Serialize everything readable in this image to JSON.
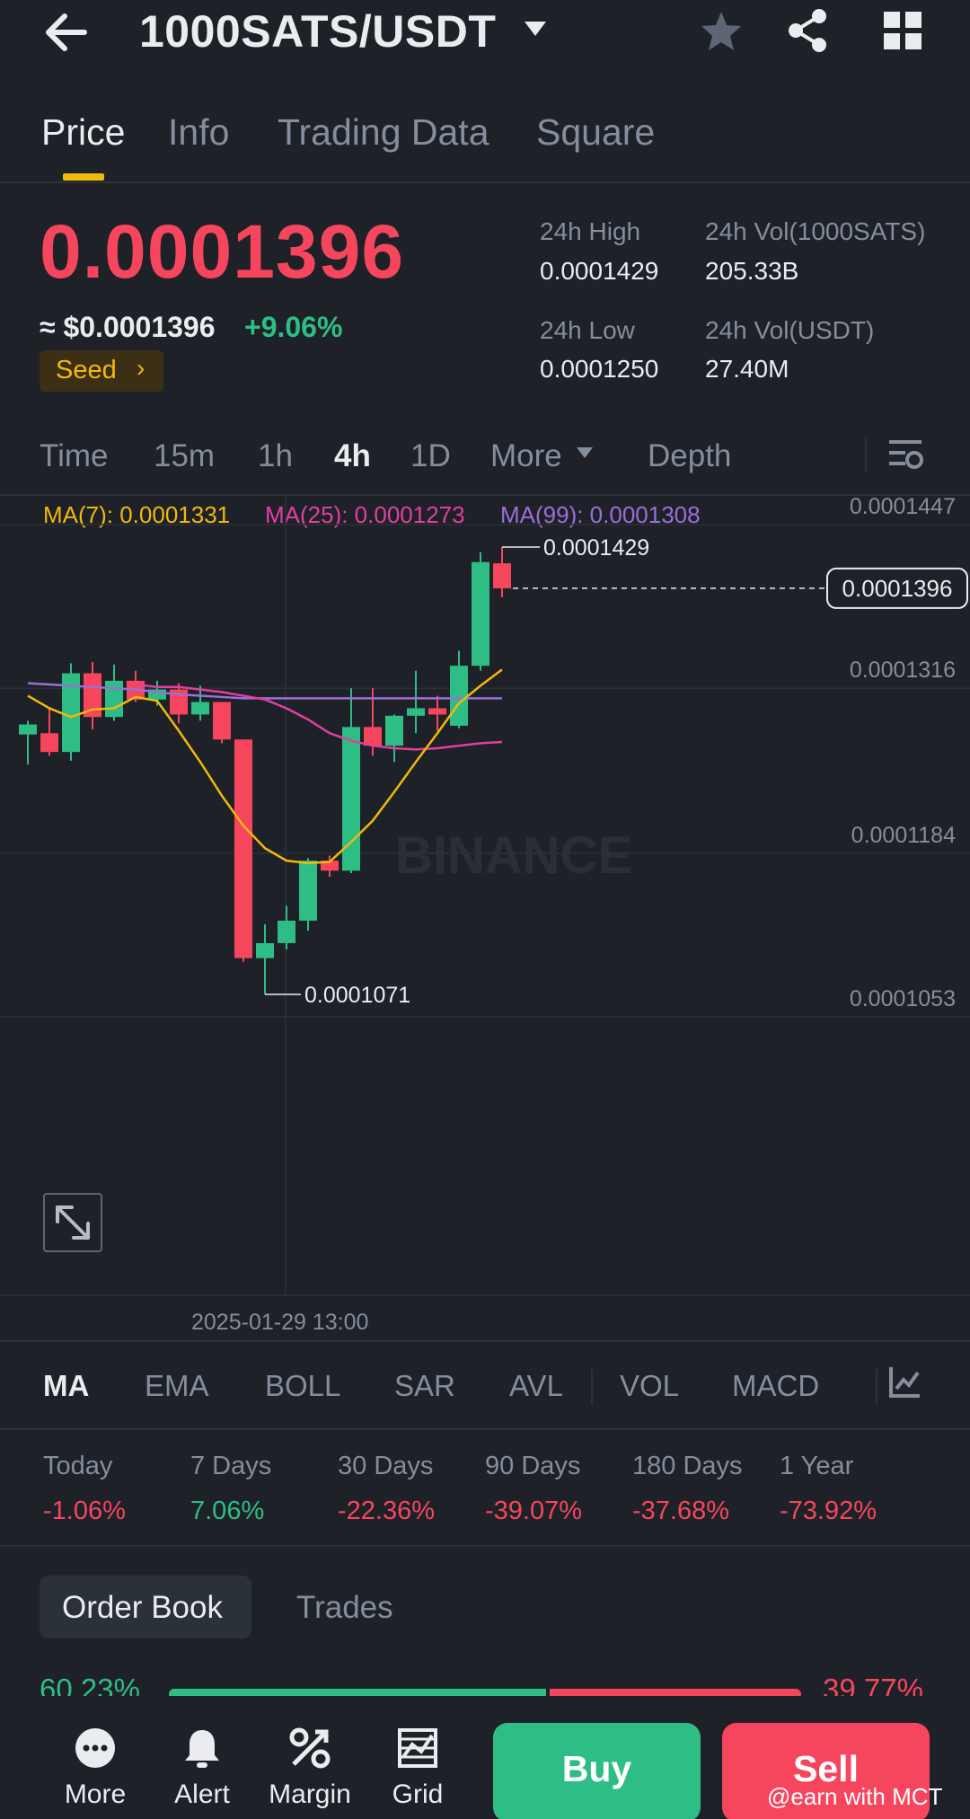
{
  "header": {
    "pair": "1000SATS/USDT",
    "icons": [
      "back-arrow-icon",
      "caret-down-icon",
      "star-icon",
      "share-icon",
      "grid-icon"
    ]
  },
  "tabs": [
    {
      "label": "Price",
      "active": true
    },
    {
      "label": "Info",
      "active": false
    },
    {
      "label": "Trading Data",
      "active": false
    },
    {
      "label": "Square",
      "active": false
    }
  ],
  "price": {
    "last": "0.0001396",
    "usd": "≈ $0.0001396",
    "change": "+9.06%",
    "tag": "Seed"
  },
  "stats": {
    "high_label": "24h High",
    "high": "0.0001429",
    "vol_base_label": "24h Vol(1000SATS)",
    "vol_base": "205.33B",
    "low_label": "24h Low",
    "low": "0.0001250",
    "vol_quote_label": "24h Vol(USDT)",
    "vol_quote": "27.40M"
  },
  "intervals": [
    {
      "label": "Time",
      "active": false
    },
    {
      "label": "15m",
      "active": false
    },
    {
      "label": "1h",
      "active": false
    },
    {
      "label": "4h",
      "active": true
    },
    {
      "label": "1D",
      "active": false
    },
    {
      "label": "More",
      "active": false
    },
    {
      "label": "Depth",
      "active": false
    }
  ],
  "ma_legend": [
    {
      "text": "MA(7): 0.0001331",
      "color": "#f0b90b"
    },
    {
      "text": "MA(25): 0.0001273",
      "color": "#e040a0"
    },
    {
      "text": "MA(99): 0.0001308",
      "color": "#9b6fd6"
    }
  ],
  "chart_data": {
    "type": "candlestick",
    "interval": "4h",
    "y_ticks": [
      "0.0001447",
      "0.0001316",
      "0.0001184",
      "0.0001053"
    ],
    "ylim": [
      0.0001053,
      0.0001447
    ],
    "x_label": "2025-01-29 13:00",
    "high_label": "0.0001429",
    "low_label": "0.0001071",
    "last_price_label": "0.0001396",
    "watermark": "BINANCE",
    "colors": {
      "up": "#2ebd85",
      "down": "#f6465d"
    },
    "candles": [
      {
        "o": 0.0001279,
        "h": 0.000129,
        "l": 0.0001255,
        "c": 0.0001287
      },
      {
        "o": 0.000128,
        "h": 0.00013,
        "l": 0.0001262,
        "c": 0.0001265
      },
      {
        "o": 0.0001265,
        "h": 0.0001336,
        "l": 0.0001258,
        "c": 0.0001328
      },
      {
        "o": 0.0001328,
        "h": 0.0001337,
        "l": 0.0001283,
        "c": 0.0001293
      },
      {
        "o": 0.0001293,
        "h": 0.0001335,
        "l": 0.000129,
        "c": 0.0001322
      },
      {
        "o": 0.0001322,
        "h": 0.000133,
        "l": 0.0001305,
        "c": 0.0001307
      },
      {
        "o": 0.0001307,
        "h": 0.0001322,
        "l": 0.0001302,
        "c": 0.0001315
      },
      {
        "o": 0.0001315,
        "h": 0.000132,
        "l": 0.0001288,
        "c": 0.0001295
      },
      {
        "o": 0.0001295,
        "h": 0.0001318,
        "l": 0.000129,
        "c": 0.0001305
      },
      {
        "o": 0.0001305,
        "h": 0.0001305,
        "l": 0.0001272,
        "c": 0.0001275
      },
      {
        "o": 0.0001275,
        "h": 0.000127,
        "l": 0.0001097,
        "c": 0.00011
      },
      {
        "o": 0.00011,
        "h": 0.0001127,
        "l": 0.0001071,
        "c": 0.0001112
      },
      {
        "o": 0.0001112,
        "h": 0.0001142,
        "l": 0.0001107,
        "c": 0.000113
      },
      {
        "o": 0.000113,
        "h": 0.000118,
        "l": 0.0001122,
        "c": 0.0001178
      },
      {
        "o": 0.0001178,
        "h": 0.0001182,
        "l": 0.0001165,
        "c": 0.000117
      },
      {
        "o": 0.000117,
        "h": 0.0001316,
        "l": 0.0001168,
        "c": 0.0001285
      },
      {
        "o": 0.0001285,
        "h": 0.0001316,
        "l": 0.0001262,
        "c": 0.000127
      },
      {
        "o": 0.000127,
        "h": 0.0001295,
        "l": 0.0001257,
        "c": 0.0001294
      },
      {
        "o": 0.0001294,
        "h": 0.000133,
        "l": 0.000128,
        "c": 0.00013
      },
      {
        "o": 0.00013,
        "h": 0.000131,
        "l": 0.0001282,
        "c": 0.0001295
      },
      {
        "o": 0.0001286,
        "h": 0.0001346,
        "l": 0.0001284,
        "c": 0.0001334
      },
      {
        "o": 0.0001334,
        "h": 0.0001425,
        "l": 0.000133,
        "c": 0.0001417
      },
      {
        "o": 0.0001416,
        "h": 0.0001429,
        "l": 0.0001389,
        "c": 0.0001396
      }
    ],
    "ma7": [
      0.000131,
      0.00013,
      0.0001293,
      0.0001299,
      0.00013,
      0.0001309,
      0.0001306,
      0.0001282,
      0.0001257,
      0.000123,
      0.0001206,
      0.0001188,
      0.0001178,
      0.0001176,
      0.0001177,
      0.0001193,
      0.000121,
      0.0001233,
      0.0001257,
      0.000128,
      0.0001304,
      0.0001318,
      0.0001331
    ],
    "ma25": [
      0.0001319,
      0.0001317,
      0.0001317,
      0.0001315,
      0.0001313,
      0.000131,
      0.0001307,
      0.00013,
      0.0001291,
      0.000128,
      0.0001274,
      0.000127,
      0.0001268,
      0.0001267,
      0.0001268,
      0.000127,
      0.0001272,
      0.0001273
    ],
    "ma99": [
      0.000132,
      0.0001319,
      0.0001318,
      0.0001317,
      0.0001316,
      0.0001315,
      0.0001313,
      0.0001311,
      0.000131,
      0.0001309,
      0.0001308,
      0.0001308,
      0.0001308,
      0.0001308,
      0.0001308,
      0.0001308,
      0.0001308,
      0.0001308,
      0.0001308,
      0.0001308,
      0.0001308,
      0.0001308,
      0.0001308
    ]
  },
  "indicators": [
    {
      "label": "MA",
      "active": true
    },
    {
      "label": "EMA",
      "active": false
    },
    {
      "label": "BOLL",
      "active": false
    },
    {
      "label": "SAR",
      "active": false
    },
    {
      "label": "AVL",
      "active": false
    },
    {
      "label": "VOL",
      "active": false
    },
    {
      "label": "MACD",
      "active": false
    }
  ],
  "performance": [
    {
      "label": "Today",
      "value": "-1.06%",
      "dir": "down"
    },
    {
      "label": "7 Days",
      "value": "7.06%",
      "dir": "up"
    },
    {
      "label": "30 Days",
      "value": "-22.36%",
      "dir": "down"
    },
    {
      "label": "90 Days",
      "value": "-39.07%",
      "dir": "down"
    },
    {
      "label": "180 Days",
      "value": "-37.68%",
      "dir": "down"
    },
    {
      "label": "1 Year",
      "value": "-73.92%",
      "dir": "down"
    }
  ],
  "order_book": {
    "tab_active": "Order Book",
    "tab_other": "Trades",
    "bid_ratio": "60.23%",
    "ask_ratio": "39.77%",
    "bid_fraction": 0.6023
  },
  "bottom_bar": {
    "items": [
      {
        "label": "More",
        "icon": "more-icon"
      },
      {
        "label": "Alert",
        "icon": "bell-icon"
      },
      {
        "label": "Margin",
        "icon": "margin-icon"
      },
      {
        "label": "Grid",
        "icon": "grid-trading-icon"
      }
    ],
    "buy": "Buy",
    "sell": "Sell"
  },
  "watermark": "@earn with MCT"
}
